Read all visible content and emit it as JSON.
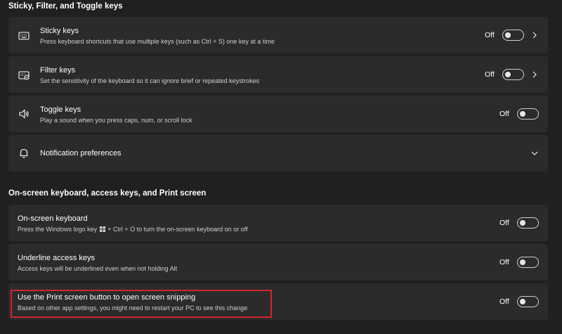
{
  "sections": [
    {
      "title": "Sticky, Filter, and Toggle keys",
      "items": [
        {
          "title": "Sticky keys",
          "description": "Press keyboard shortcuts that use multiple keys (such as Ctrl + S) one key at a time",
          "state": "Off",
          "icon": "keyboard-icon",
          "has_chevron": true
        },
        {
          "title": "Filter keys",
          "description": "Set the sensitivity of the keyboard so it can ignore brief or repeated keystrokes",
          "state": "Off",
          "icon": "keyboard-filter-icon",
          "has_chevron": true
        },
        {
          "title": "Toggle keys",
          "description": "Play a sound when you press caps, num, or scroll lock",
          "state": "Off",
          "icon": "speaker-icon",
          "has_chevron": false
        },
        {
          "title": "Notification preferences",
          "icon": "bell-icon",
          "expand": "chevron-down-icon"
        }
      ]
    },
    {
      "title": "On-screen keyboard, access keys, and Print screen",
      "items": [
        {
          "title": "On-screen keyboard",
          "description_before": "Press the Windows logo key",
          "description_after": "+ Ctrl + O to turn the on-screen keyboard on or off",
          "state": "Off"
        },
        {
          "title": "Underline access keys",
          "description": "Access keys will be underlined even when not holding Alt",
          "state": "Off"
        },
        {
          "title": "Use the Print screen button to open screen snipping",
          "description": "Based on other app settings, you might need to restart your PC to see this change",
          "state": "Off",
          "highlighted": true
        }
      ]
    }
  ],
  "colors": {
    "background": "#202020",
    "card": "#2b2b2b",
    "highlight_border": "#d4242a"
  }
}
